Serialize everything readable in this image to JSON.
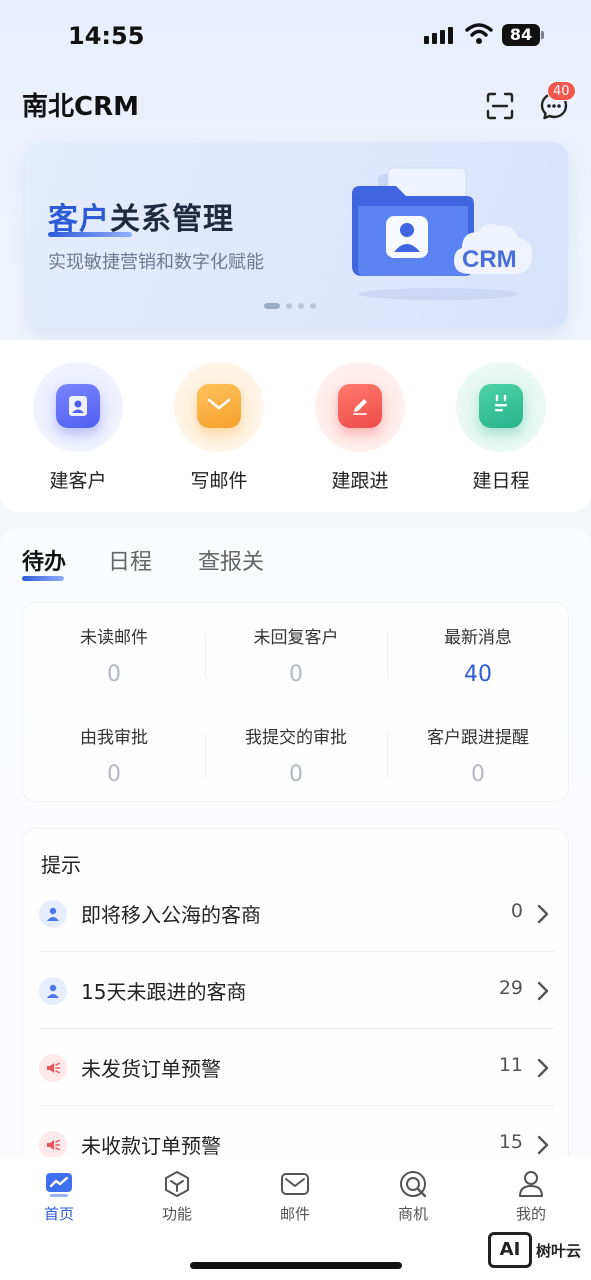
{
  "status_bar": {
    "time": "14:55",
    "battery": "84"
  },
  "header": {
    "title": "南北CRM",
    "message_badge": "40",
    "icons": [
      "scan-icon",
      "chat-bubble-icon"
    ]
  },
  "banner": {
    "title_highlight": "客户",
    "title_rest": "关系管理",
    "subtitle": "实现敏捷营销和数字化赋能",
    "art_label": "CRM",
    "slide_index": 1,
    "slide_count": 4
  },
  "quick_actions": [
    {
      "label": "建客户",
      "icon": "user-card-icon",
      "color": "#4f5ff0"
    },
    {
      "label": "写邮件",
      "icon": "envelope-icon",
      "color": "#f5a12c"
    },
    {
      "label": "建跟进",
      "icon": "pencil-icon",
      "color": "#ee4b47"
    },
    {
      "label": "建日程",
      "icon": "calendar-icon",
      "color": "#27b38a"
    }
  ],
  "tabs": [
    {
      "label": "待办",
      "active": true
    },
    {
      "label": "日程",
      "active": false
    },
    {
      "label": "查报关",
      "active": false
    }
  ],
  "todo": [
    {
      "label": "未读邮件",
      "value": "0"
    },
    {
      "label": "未回复客户",
      "value": "0"
    },
    {
      "label": "最新消息",
      "value": "40"
    },
    {
      "label": "由我审批",
      "value": "0"
    },
    {
      "label": "我提交的审批",
      "value": "0"
    },
    {
      "label": "客户跟进提醒",
      "value": "0"
    }
  ],
  "tips": {
    "title": "提示",
    "rows": [
      {
        "text": "即将移入公海的客商",
        "count": "0",
        "icon": "user-icon"
      },
      {
        "text": "15天未跟进的客商",
        "count": "29",
        "icon": "user-icon"
      },
      {
        "text": "未发货订单预警",
        "count": "11",
        "icon": "speaker-icon"
      },
      {
        "text": "未收款订单预警",
        "count": "15",
        "icon": "speaker-icon"
      }
    ]
  },
  "bottom_nav": [
    {
      "label": "首页",
      "icon": "chart-home-icon",
      "active": true
    },
    {
      "label": "功能",
      "icon": "cube-icon",
      "active": false
    },
    {
      "label": "邮件",
      "icon": "mail-icon",
      "active": false
    },
    {
      "label": "商机",
      "icon": "target-icon",
      "active": false
    },
    {
      "label": "我的",
      "icon": "person-icon",
      "active": false
    }
  ],
  "watermark": {
    "logo": "AI",
    "text": "树叶云"
  },
  "colors": {
    "accent": "#2d5bd6",
    "badge": "#f2574e"
  }
}
